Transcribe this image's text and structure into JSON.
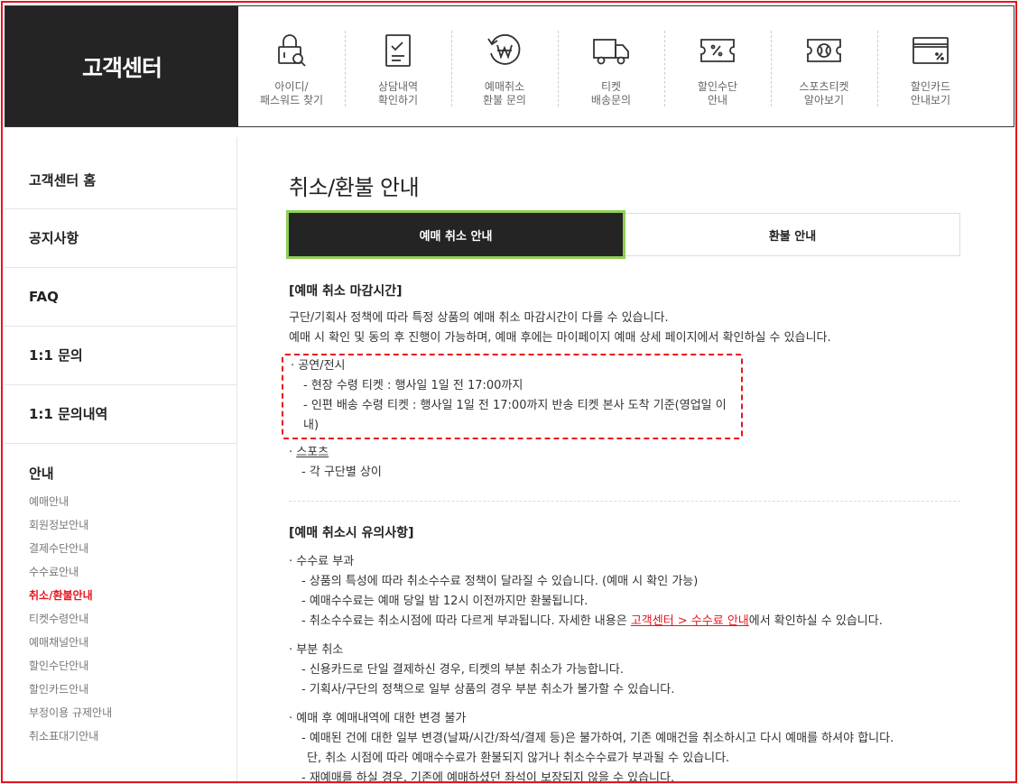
{
  "header": {
    "brand": "고객센터",
    "quick_menu": [
      {
        "icon": "lock-search-icon",
        "label": "아이디/\n패스워드 찾기"
      },
      {
        "icon": "clipboard-check-icon",
        "label": "상담내역\n확인하기"
      },
      {
        "icon": "won-refund-icon",
        "label": "예매취소\n환불 문의"
      },
      {
        "icon": "delivery-truck-icon",
        "label": "티켓\n배송문의"
      },
      {
        "icon": "discount-ticket-icon",
        "label": "할인수단\n안내"
      },
      {
        "icon": "sports-ticket-icon",
        "label": "스포츠티켓\n알아보기"
      },
      {
        "icon": "credit-card-icon",
        "label": "할인카드\n안내보기"
      }
    ]
  },
  "sidebar": {
    "links": [
      "고객센터 홈",
      "공지사항",
      "FAQ",
      "1:1 문의",
      "1:1 문의내역"
    ],
    "group_title": "안내",
    "sub_items": [
      "예매안내",
      "회원정보안내",
      "결제수단안내",
      "수수료안내",
      "취소/환불안내",
      "티켓수령안내",
      "예매채널안내",
      "할인수단안내",
      "할인카드안내",
      "부정이용 규제안내",
      "취소표대기안내"
    ],
    "active_sub": "취소/환불안내"
  },
  "main": {
    "title": "취소/환불 안내",
    "tabs": [
      "예매 취소 안내",
      "환불 안내"
    ],
    "section1": {
      "title": "[예매 취소 마감시간]",
      "p1": "구단/기획사 정책에 따라 특정 상품의 예매 취소 마감시간이 다를 수 있습니다.",
      "p2": "예매 시 확인 및 동의 후 진행이 가능하며, 예매 후에는 마이페이지 예매 상세 페이지에서 확인하실 수 있습니다.",
      "perf_bullet": "· 공연/전시",
      "perf_item1": "- 현장 수령 티켓 : 행사일 1일 전 17:00까지",
      "perf_item2": "- 인편 배송 수령 티켓 : 행사일 1일 전 17:00까지 반송 티켓 본사 도착 기준(영업일 이내)",
      "sports_prefix": "· ",
      "sports_label": "스포츠",
      "sports_item": "- 각 구단별 상이"
    },
    "section2": {
      "title": "[예매 취소시 유의사항]",
      "fee_bullet": "· 수수료 부과",
      "fee_item1": "- 상품의 특성에 따라 취소수수료 정책이 달라질 수 있습니다. (예매 시 확인 가능)",
      "fee_item2": "- 예매수수료는 예매 당일 밤 12시 이전까지만 환불됩니다.",
      "fee_item3_pre": "- 취소수수료는 취소시점에 따라 다르게 부과됩니다. 자세한 내용은 ",
      "fee_item3_link": "고객센터 > 수수료 안내",
      "fee_item3_post": "에서 확인하실 수 있습니다.",
      "partial_bullet": "· 부분 취소",
      "partial_item1": "- 신용카드로 단일 결제하신 경우, 티켓의 부분 취소가 가능합니다.",
      "partial_item2": "- 기획사/구단의 정책으로 일부 상품의 경우 부분 취소가 불가할 수 있습니다.",
      "change_bullet": "· 예매 후 예매내역에 대한 변경 불가",
      "change_item1": "- 예매된 건에 대한 일부 변경(날짜/시간/좌석/결제 등)은 불가하여, 기존 예매건을 취소하시고 다시 예매를 하셔야 합니다.",
      "change_item1_cont": "단, 취소 시점에 따라 예매수수료가 환불되지 않거나 취소수수료가 부과될 수 있습니다.",
      "change_item2": "- 재예매를 하실 경우, 기존에 예매하셨던 좌석이 보장되지 않을 수 있습니다."
    }
  },
  "colors": {
    "accent": "#e8141c",
    "dark": "#242424",
    "tab_outline": "#8fce57"
  }
}
